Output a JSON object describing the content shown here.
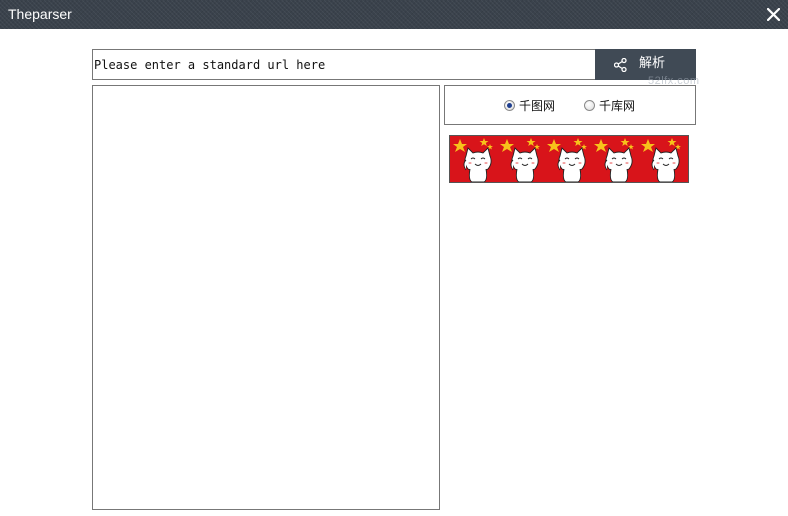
{
  "window": {
    "title": "Theparser"
  },
  "url_bar": {
    "placeholder": "Please enter a standard url here",
    "value": ""
  },
  "parse_button": {
    "label": "解析",
    "icon": "share-icon"
  },
  "watermark": "52lfx.com",
  "sources": {
    "options": [
      {
        "label": "千图网",
        "selected": true
      },
      {
        "label": "千库网",
        "selected": false
      }
    ]
  },
  "banner": {
    "image": "cartoon-cats-with-stars",
    "background_color": "#d8141a",
    "star_color": "#f7c21b",
    "cat_count": 5
  },
  "output": {
    "value": ""
  }
}
